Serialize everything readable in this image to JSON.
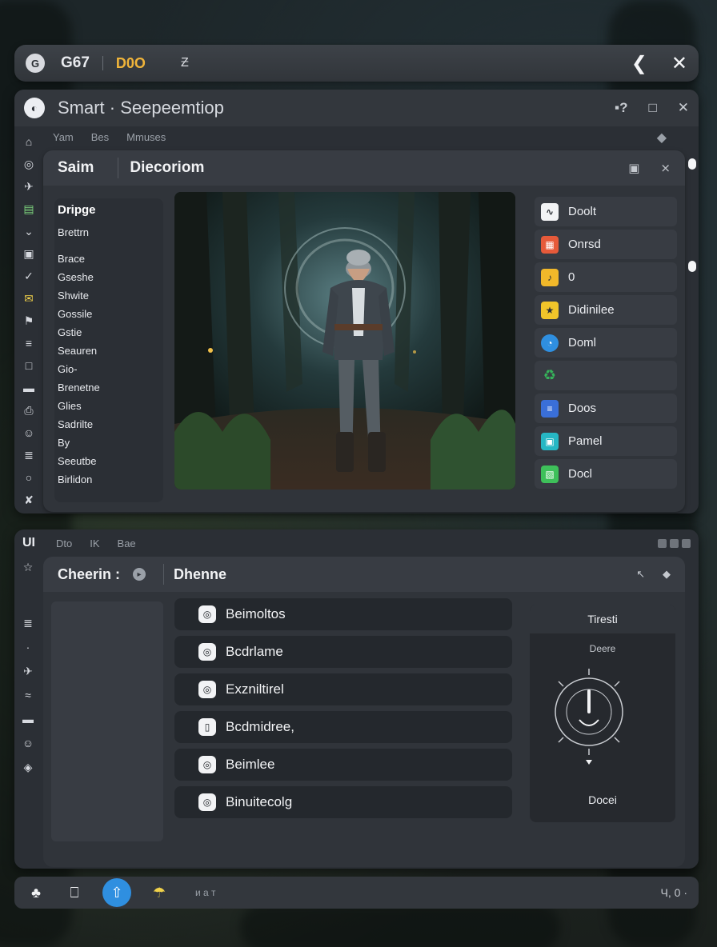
{
  "topbar": {
    "icon": "G",
    "label1": "G67",
    "label2": "D0O",
    "label3": "Ƶ",
    "right_icons": [
      "back-arrow-icon",
      "close-x-icon"
    ]
  },
  "window1": {
    "title": "Smart · Seepeemtiop",
    "controls": [
      "▪?",
      "□",
      "✕"
    ],
    "tabs": [
      "Yam",
      "Bes",
      "Mmuses"
    ],
    "inner": {
      "tab_a": "Saim",
      "tab_b": "Diecoriom",
      "left_heading": "Dripge",
      "left_sub": "Brettrn",
      "left_items": [
        "Brace",
        "Gseshe",
        "Shwite",
        "Gossile",
        "Gstie",
        "Seauren",
        "Gio-",
        "Brenetne",
        "Glies",
        "Sadrilte",
        "By",
        "Seeutbe",
        "Birlidon"
      ],
      "right_items": [
        {
          "label": "Doolt",
          "icon": "chart-icon",
          "color": "#f2f3f5"
        },
        {
          "label": "Onrsd",
          "icon": "grid-icon",
          "color": "#e65a3a"
        },
        {
          "label": "0",
          "icon": "music-icon",
          "color": "#f1b82a"
        },
        {
          "label": "Didinilee",
          "icon": "star-icon",
          "color": "#f1c52a"
        },
        {
          "label": "Doml",
          "icon": "globe-icon",
          "color": "#2f8fe0"
        },
        {
          "label": "",
          "icon": "recycle-icon",
          "color": "#36b25a"
        },
        {
          "label": "Doos",
          "icon": "doc-icon",
          "color": "#3a6fd8"
        },
        {
          "label": "Pamel",
          "icon": "panel-icon",
          "color": "#26b7c4"
        },
        {
          "label": "Docl",
          "icon": "image-icon",
          "color": "#3ec05a"
        }
      ]
    }
  },
  "window2": {
    "logo": "UI",
    "tabs": [
      "Dto",
      "IK",
      "Bae"
    ],
    "inner": {
      "tab_a": "Cheerin :",
      "tab_b": "Dhenne",
      "buttons": [
        "Beimoltos",
        "Bcdrlame",
        "Exzniltirel",
        "Bcdmidree,",
        "Beimlee",
        "Binuitecolg"
      ],
      "clock_panel": {
        "top": "Tiresti",
        "caption": "Deere",
        "footer": "Docei"
      }
    }
  },
  "dock": {
    "small": "и а т",
    "right": "Ч, 0 ·"
  },
  "accent_color": "#2f8fe0"
}
